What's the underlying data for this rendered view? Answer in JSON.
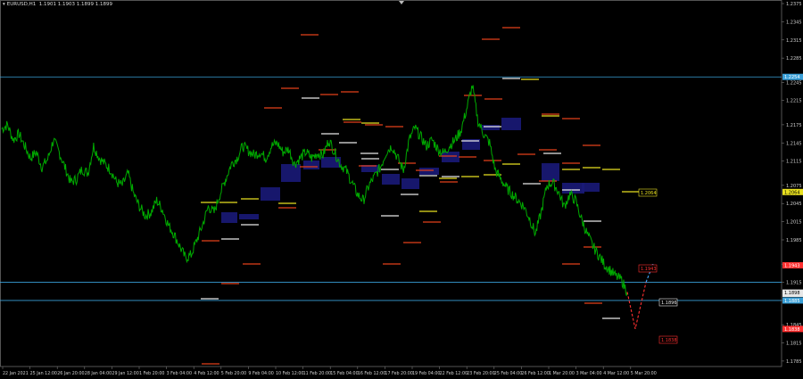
{
  "window": {
    "symbol_label": "EURUSD,H1",
    "ohlc_values": "1.1901 1.1903 1.1899 1.1899"
  },
  "colors": {
    "background": "#000000",
    "price_line": "#00aa00",
    "axis": "#777777",
    "hline_blue": "#3aa0d8",
    "zone_navy": "#1a1a78",
    "level_orange": "#e2401a",
    "level_yellow": "#e8e020",
    "level_white": "#e8e8e8",
    "level_gray": "#999999",
    "projection_red": "#ff3030",
    "projection_blue": "#40a8ff"
  },
  "chart_data": {
    "type": "line",
    "title": "",
    "symbol": "EURUSD",
    "timeframe": "H1",
    "ylim": [
      1.1776,
      1.2375
    ],
    "y_ticks": [
      "1.2375",
      "1.2345",
      "1.2315",
      "1.2285",
      "1.2245",
      "1.2215",
      "1.2175",
      "1.2145",
      "1.2115",
      "1.2075",
      "1.2045",
      "1.2015",
      "1.1985",
      "1.1945",
      "1.1915",
      "1.1885",
      "1.1845",
      "1.1815",
      "1.1785"
    ],
    "x_ticks": [
      "22 Jan 2021",
      "25 Jan 12:00",
      "26 Jan 20:00",
      "28 Jan 04:00",
      "29 Jan 12:00",
      "1 Feb 20:00",
      "3 Feb 04:00",
      "4 Feb 12:00",
      "5 Feb 20:00",
      "9 Feb 04:00",
      "10 Feb 12:00",
      "11 Feb 20:00",
      "15 Feb 04:00",
      "16 Feb 12:00",
      "17 Feb 20:00",
      "19 Feb 04:00",
      "22 Feb 12:00",
      "23 Feb 20:00",
      "25 Feb 04:00",
      "26 Feb 12:00",
      "1 Mar 20:00",
      "3 Mar 04:00",
      "4 Mar 12:00",
      "5 Mar 20:00"
    ],
    "series": [
      {
        "x_range": [
          "22 Jan 2021",
          "5 Mar 20:00"
        ],
        "values": [
          1.2168,
          1.2175,
          1.215,
          1.216,
          1.214,
          1.212,
          1.213,
          1.2105,
          1.2118,
          1.215,
          1.213,
          1.2105,
          1.208,
          1.2085,
          1.2102,
          1.2095,
          1.214,
          1.212,
          1.211,
          1.21,
          1.208,
          1.2075,
          1.2095,
          1.206,
          1.204,
          1.2025,
          1.203,
          1.205,
          1.2035,
          1.201,
          1.1995,
          1.1975,
          1.1955,
          1.196,
          1.1985,
          1.201,
          1.204,
          1.203,
          1.206,
          1.2085,
          1.211,
          1.212,
          1.214,
          1.2132,
          1.2125,
          1.213,
          1.212,
          1.214,
          1.2145,
          1.213,
          1.2135,
          1.211,
          1.212,
          1.213,
          1.212,
          1.2128,
          1.2125,
          1.215,
          1.213,
          1.211,
          1.21,
          1.208,
          1.206,
          1.205,
          1.2075,
          1.209,
          1.2105,
          1.213,
          1.214,
          1.212,
          1.21,
          1.215,
          1.217,
          1.2155,
          1.214,
          1.215,
          1.2135,
          1.2128,
          1.214,
          1.215,
          1.2165,
          1.22,
          1.224,
          1.218,
          1.216,
          1.2145,
          1.21,
          1.2085,
          1.207,
          1.206,
          1.205,
          1.204,
          1.202,
          1.1995,
          1.203,
          1.2075,
          1.208,
          1.2065,
          1.204,
          1.206,
          1.205,
          1.202,
          1.1995,
          1.1975,
          1.196,
          1.1945,
          1.1935,
          1.1925,
          1.1919,
          1.1899
        ]
      }
    ],
    "price_labels": [
      {
        "value": "1.2254",
        "style": "blue"
      },
      {
        "value": "1.2064",
        "style": "yellow"
      },
      {
        "value": "1.1943",
        "style": "red"
      },
      {
        "value": "1.1896",
        "style": "white"
      },
      {
        "value": "1.1898",
        "style": "white"
      },
      {
        "value": "1.1885",
        "style": "blue"
      },
      {
        "value": "1.1838",
        "style": "red"
      }
    ],
    "horizontal_lines": [
      1.2254,
      1.1915,
      1.1885
    ],
    "grid": false,
    "legend": "none"
  }
}
